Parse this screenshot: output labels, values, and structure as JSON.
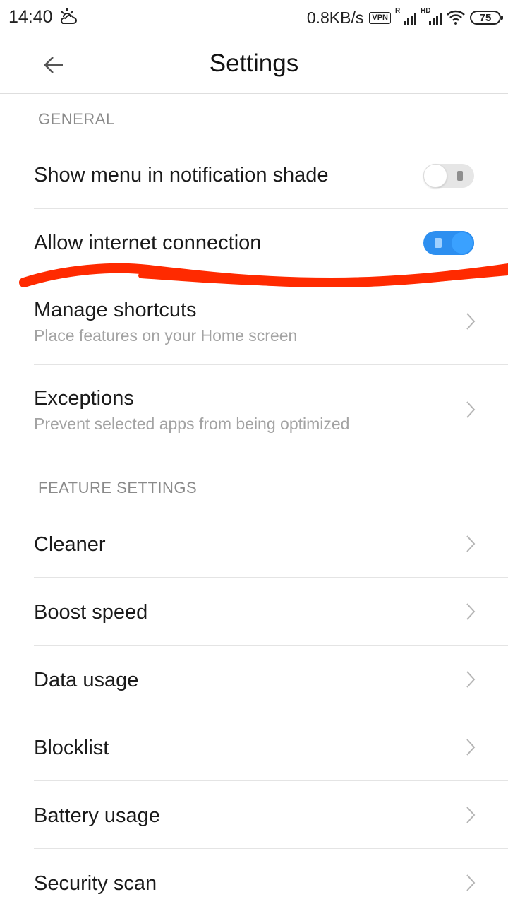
{
  "status_bar": {
    "time": "14:40",
    "weather_icon": "partly-cloudy-icon",
    "net_speed": "0.8KB/s",
    "vpn": "VPN",
    "signal_1_tag": "R",
    "signal_2_tag": "HD",
    "battery": "75"
  },
  "header": {
    "title": "Settings",
    "back_icon": "arrow-left-icon"
  },
  "general": {
    "header": "GENERAL",
    "show_menu": {
      "label": "Show menu in notification shade",
      "enabled": false
    },
    "allow_internet": {
      "label": "Allow internet connection",
      "enabled": true
    },
    "manage_shortcuts": {
      "label": "Manage shortcuts",
      "subtitle": "Place features on your Home screen"
    },
    "exceptions": {
      "label": "Exceptions",
      "subtitle": "Prevent selected apps from being optimized"
    }
  },
  "feature_settings": {
    "header": "FEATURE SETTINGS",
    "items": [
      {
        "label": "Cleaner"
      },
      {
        "label": "Boost speed"
      },
      {
        "label": "Data usage"
      },
      {
        "label": "Blocklist"
      },
      {
        "label": "Battery usage"
      },
      {
        "label": "Security scan"
      }
    ]
  },
  "colors": {
    "accent": "#2d8ff0",
    "annotation": "#ff2a00"
  }
}
